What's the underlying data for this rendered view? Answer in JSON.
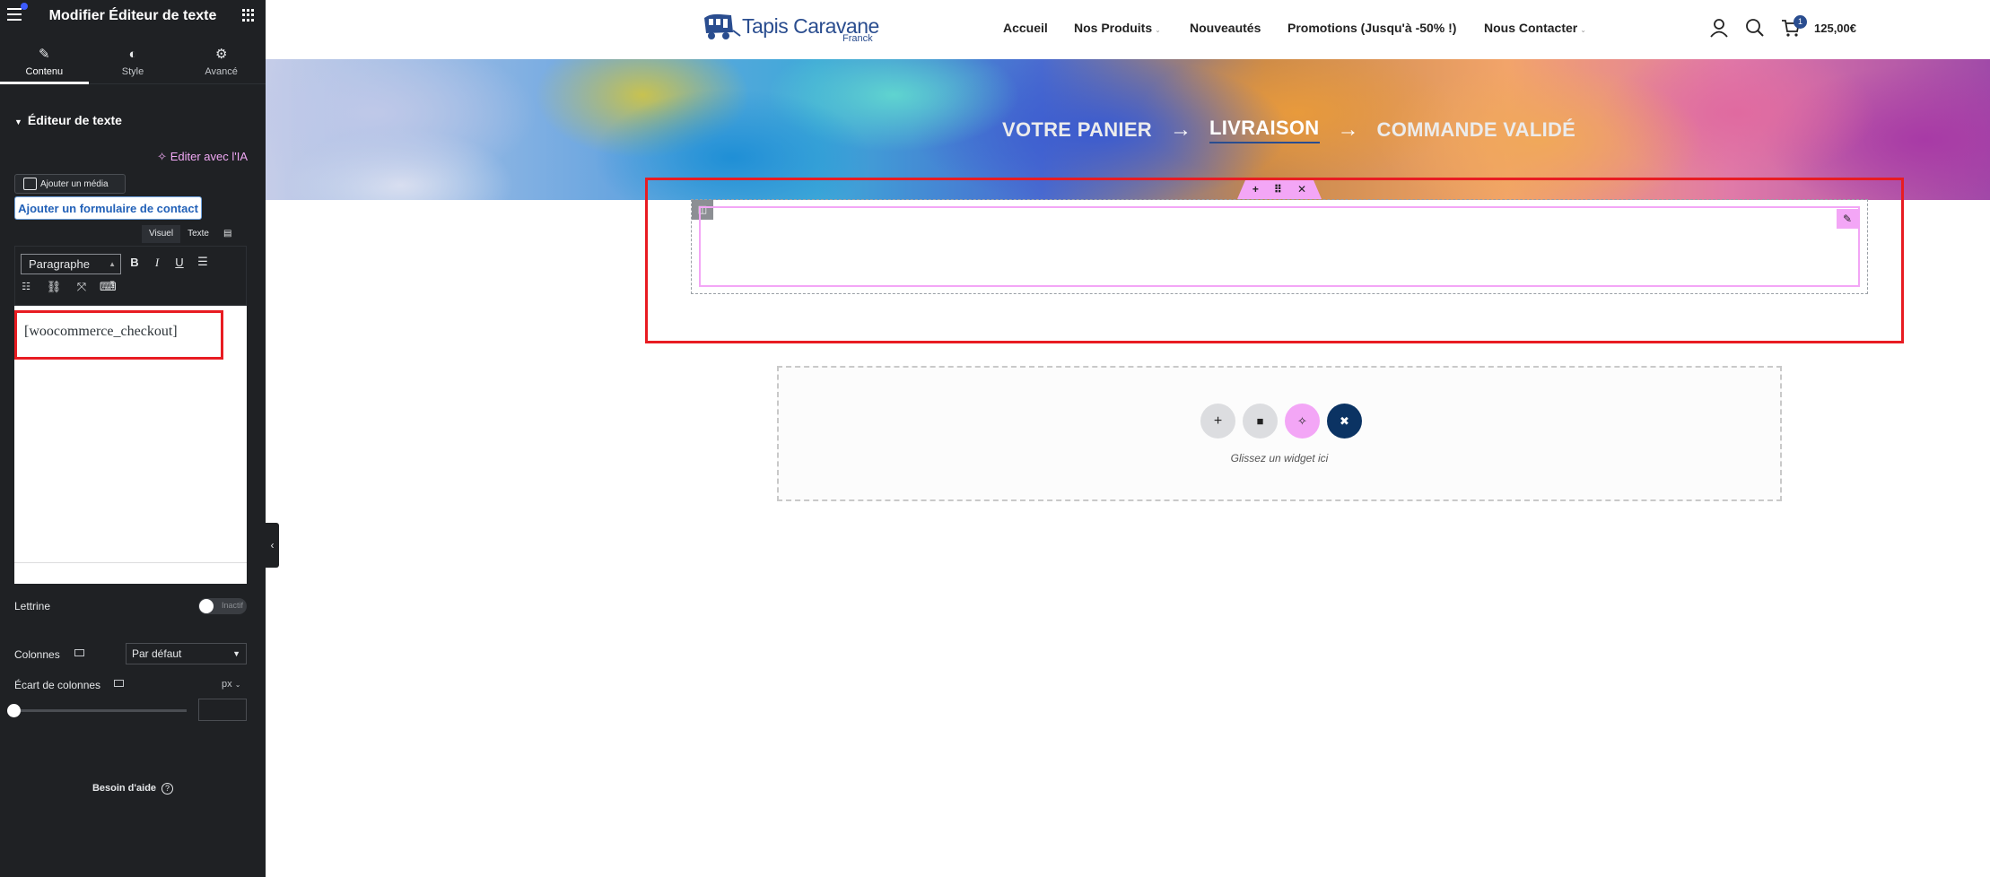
{
  "panel": {
    "title": "Modifier Éditeur de texte",
    "tabs": [
      {
        "label": "Contenu",
        "icon": "pencil-icon"
      },
      {
        "label": "Style",
        "icon": "contrast-icon"
      },
      {
        "label": "Avancé",
        "icon": "gear-icon"
      }
    ],
    "section_title": "Éditeur de texte",
    "ai_link": "Editer avec l'IA",
    "add_media": "Ajouter un média",
    "add_contact_form": "Ajouter un formulaire de contact",
    "mode_visual": "Visuel",
    "mode_text": "Texte",
    "format_select": "Paragraphe",
    "editor_content": "[woocommerce_checkout]",
    "dropcap_label": "Lettrine",
    "dropcap_state": "Inactif",
    "columns_label": "Colonnes",
    "columns_value": "Par défaut",
    "column_gap_label": "Écart de colonnes",
    "column_gap_unit": "px",
    "help": "Besoin d'aide"
  },
  "site": {
    "logo_name": "Tapis Caravane",
    "logo_sub": "Franck",
    "nav": [
      "Accueil",
      "Nos Produits",
      "Nouveautés",
      "Promotions (Jusqu'à -50% !)",
      "Nous Contacter"
    ],
    "cart_count": "1",
    "cart_total": "125,00€",
    "steps": [
      "VOTRE PANIER",
      "LIVRAISON",
      "COMMANDE VALIDÉ"
    ],
    "step_arrow": "→",
    "drop_zone_text": "Glissez un widget ici"
  },
  "colors": {
    "panel_bg": "#1f2124",
    "highlight_red": "#e81c22",
    "elementor_pink": "#f3a6f6",
    "brand_blue": "#2a4d8f"
  }
}
